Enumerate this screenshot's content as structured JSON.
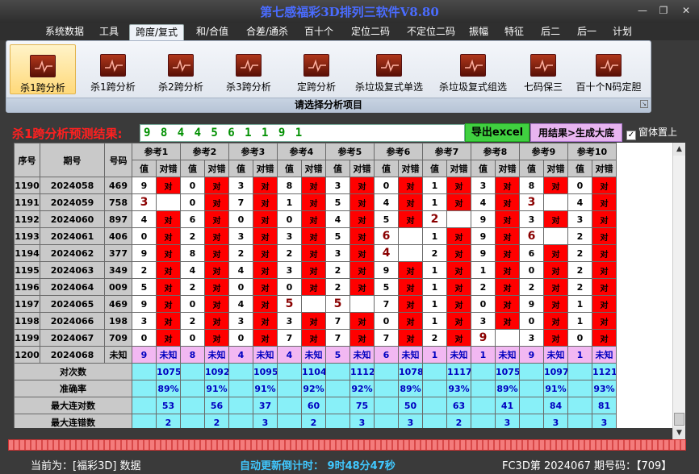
{
  "app": {
    "title": "第七感福彩3D排列三软件V8.80"
  },
  "window_controls": {
    "minimize": "—",
    "restore": "❐",
    "close": "✕"
  },
  "menu": [
    "系统数据",
    "工具",
    "跨度/复式",
    "和/合值",
    "合差/通杀",
    "百十个",
    "定位二码",
    "不定位二码",
    "振幅",
    "特征",
    "后二",
    "后一",
    "计划"
  ],
  "active_menu": 2,
  "ribbon": {
    "buttons": [
      "杀1跨分析",
      "杀1跨分析",
      "杀2跨分析",
      "杀3跨分析",
      "定跨分析",
      "杀垃圾复式单选",
      "杀垃圾复式组选",
      "七码保三",
      "百十个N码定胆"
    ],
    "active": 0,
    "group_label": "请选择分析项目"
  },
  "result": {
    "label": "杀1跨分析预测结果:",
    "value": "9 8 4 4 5 6 1 1 9 1",
    "export_button": "导出excel",
    "generate_button": "用结果>生成大底",
    "pin_label": "窗体置上",
    "pin_checked": "✓"
  },
  "table": {
    "col_seq": "序号",
    "col_issue": "期号",
    "col_code": "号码",
    "refs": [
      "参考1",
      "参考2",
      "参考3",
      "参考4",
      "参考5",
      "参考6",
      "参考7",
      "参考8",
      "参考9",
      "参考10"
    ],
    "sub_value": "值",
    "sub_mark": "对错",
    "hit_text": "对",
    "rows": [
      {
        "seq": "1190",
        "issue": "2024058",
        "code": "469",
        "vals": [
          "9",
          "0",
          "3",
          "8",
          "3",
          "0",
          "1",
          "3",
          "8",
          "0"
        ],
        "hits": [
          1,
          1,
          1,
          1,
          1,
          1,
          1,
          1,
          1,
          1
        ],
        "big": []
      },
      {
        "seq": "1191",
        "issue": "2024059",
        "code": "758",
        "vals": [
          "3",
          "0",
          "7",
          "1",
          "5",
          "4",
          "1",
          "4",
          "3",
          "4"
        ],
        "hits": [
          0,
          1,
          1,
          1,
          1,
          1,
          1,
          1,
          0,
          1
        ],
        "big": [
          0,
          8
        ]
      },
      {
        "seq": "1192",
        "issue": "2024060",
        "code": "897",
        "vals": [
          "4",
          "6",
          "0",
          "0",
          "4",
          "5",
          "2",
          "9",
          "3",
          "3"
        ],
        "hits": [
          1,
          1,
          1,
          1,
          1,
          1,
          0,
          1,
          1,
          1
        ],
        "big": [
          6
        ]
      },
      {
        "seq": "1193",
        "issue": "2024061",
        "code": "406",
        "vals": [
          "0",
          "2",
          "3",
          "3",
          "5",
          "6",
          "1",
          "9",
          "6",
          "2"
        ],
        "hits": [
          1,
          1,
          1,
          1,
          1,
          0,
          1,
          1,
          0,
          1
        ],
        "big": [
          5,
          8
        ]
      },
      {
        "seq": "1194",
        "issue": "2024062",
        "code": "377",
        "vals": [
          "9",
          "8",
          "2",
          "2",
          "3",
          "4",
          "2",
          "9",
          "6",
          "2"
        ],
        "hits": [
          1,
          1,
          1,
          1,
          1,
          0,
          1,
          1,
          1,
          1
        ],
        "big": [
          5
        ]
      },
      {
        "seq": "1195",
        "issue": "2024063",
        "code": "349",
        "vals": [
          "2",
          "4",
          "4",
          "3",
          "2",
          "9",
          "1",
          "1",
          "0",
          "2"
        ],
        "hits": [
          1,
          1,
          1,
          1,
          1,
          1,
          1,
          1,
          1,
          1
        ],
        "big": []
      },
      {
        "seq": "1196",
        "issue": "2024064",
        "code": "009",
        "vals": [
          "5",
          "2",
          "0",
          "0",
          "2",
          "5",
          "1",
          "2",
          "2",
          "2"
        ],
        "hits": [
          1,
          1,
          1,
          1,
          1,
          1,
          1,
          1,
          1,
          1
        ],
        "big": []
      },
      {
        "seq": "1197",
        "issue": "2024065",
        "code": "469",
        "vals": [
          "9",
          "0",
          "4",
          "5",
          "5",
          "7",
          "1",
          "0",
          "9",
          "1"
        ],
        "hits": [
          1,
          1,
          1,
          0,
          0,
          1,
          1,
          1,
          1,
          1
        ],
        "big": [
          3,
          4
        ]
      },
      {
        "seq": "1198",
        "issue": "2024066",
        "code": "198",
        "vals": [
          "3",
          "2",
          "3",
          "3",
          "7",
          "0",
          "1",
          "3",
          "0",
          "1"
        ],
        "hits": [
          1,
          1,
          1,
          1,
          1,
          1,
          1,
          1,
          1,
          1
        ],
        "big": []
      },
      {
        "seq": "1199",
        "issue": "2024067",
        "code": "709",
        "vals": [
          "0",
          "0",
          "0",
          "7",
          "7",
          "7",
          "2",
          "9",
          "3",
          "0"
        ],
        "hits": [
          1,
          1,
          1,
          1,
          1,
          1,
          1,
          0,
          1,
          1
        ],
        "big": [
          7
        ]
      }
    ],
    "predict_row": {
      "seq": "1200",
      "issue": "2024068",
      "code": "未知",
      "vals": [
        "9",
        "8",
        "4",
        "4",
        "5",
        "6",
        "1",
        "1",
        "9",
        "1"
      ],
      "mark": "未知"
    },
    "stats": [
      {
        "label": "对次数",
        "values": [
          "1075",
          "1092",
          "1095",
          "1104",
          "1112",
          "1078",
          "1117",
          "1075",
          "1097",
          "1121"
        ]
      },
      {
        "label": "准确率",
        "values": [
          "89%",
          "91%",
          "91%",
          "92%",
          "92%",
          "89%",
          "93%",
          "89%",
          "91%",
          "93%"
        ]
      },
      {
        "label": "最大连对数",
        "values": [
          "53",
          "56",
          "37",
          "60",
          "75",
          "50",
          "63",
          "41",
          "84",
          "81"
        ]
      },
      {
        "label": "最大连错数",
        "values": [
          "2",
          "2",
          "3",
          "2",
          "3",
          "3",
          "2",
          "3",
          "3",
          "3"
        ]
      }
    ]
  },
  "scroll": {
    "up": "▲",
    "down": "▼"
  },
  "status": {
    "current": "当前为：[福彩3D] 数据",
    "countdown": "自动更新倒计时： 9时48分47秒",
    "issue": "FC3D第 2024067 期号码：【709】"
  }
}
